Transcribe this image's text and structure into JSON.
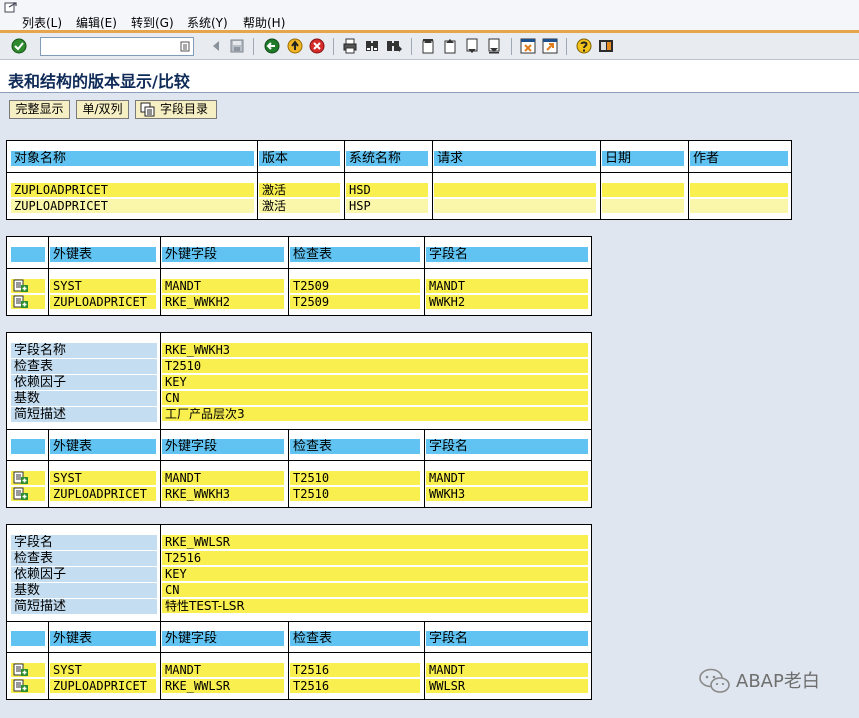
{
  "menu": [
    "列表(L)",
    "编辑(E)",
    "转到(G)",
    "系统(Y)",
    "帮助(H)"
  ],
  "page_title": "表和结构的版本显示/比较",
  "app_buttons": [
    "完整显示",
    "单/双列",
    "字段目录"
  ],
  "version_table": {
    "headers": [
      "对象名称",
      "版本",
      "系统名称",
      "请求",
      "日期",
      "作者"
    ],
    "rows": [
      [
        "ZUPLOADPRICET",
        "激活",
        "HSD",
        "",
        "",
        ""
      ],
      [
        "ZUPLOADPRICET",
        "激活",
        "HSP",
        "",
        "",
        ""
      ]
    ]
  },
  "fk_headers": [
    "外键表",
    "外键字段",
    "检查表",
    "字段名"
  ],
  "detail_labels": [
    "字段名称",
    "检查表",
    "依赖因子",
    "基数",
    "简短描述"
  ],
  "detail_labels_b": [
    "字段名",
    "检查表",
    "依赖因子",
    "基数",
    "简短描述"
  ],
  "fk_block1": {
    "rows": [
      [
        "SYST",
        "MANDT",
        "T2509",
        "MANDT"
      ],
      [
        "ZUPLOADPRICET",
        "RKE_WWKH2",
        "T2509",
        "WWKH2"
      ]
    ]
  },
  "fk_block2": {
    "details": [
      "RKE_WWKH3",
      "T2510",
      "KEY",
      "CN",
      "工厂产品层次3"
    ],
    "rows": [
      [
        "SYST",
        "MANDT",
        "T2510",
        "MANDT"
      ],
      [
        "ZUPLOADPRICET",
        "RKE_WWKH3",
        "T2510",
        "WWKH3"
      ]
    ]
  },
  "fk_block3": {
    "details": [
      "RKE_WWLSR",
      "T2516",
      "KEY",
      "CN",
      "特性TEST-LSR"
    ],
    "rows": [
      [
        "SYST",
        "MANDT",
        "T2516",
        "MANDT"
      ],
      [
        "ZUPLOADPRICET",
        "RKE_WWLSR",
        "T2516",
        "WWLSR"
      ]
    ]
  },
  "watermark": "ABAP老白",
  "toolbar_icons": [
    "enter-icon",
    "save-icon",
    "back-icon",
    "exit-icon",
    "cancel-icon",
    "print-icon",
    "find-icon",
    "find-next-icon",
    "first-page-icon",
    "prev-page-icon",
    "next-page-icon",
    "last-page-icon",
    "new-session-icon",
    "shortcut-icon",
    "help-icon",
    "settings-icon"
  ],
  "colors": {
    "header": "#60c3f2",
    "field": "#f9ef4f",
    "label": "#c4ddf0",
    "title": "#0e2a57",
    "accent": "#e7a54b"
  }
}
